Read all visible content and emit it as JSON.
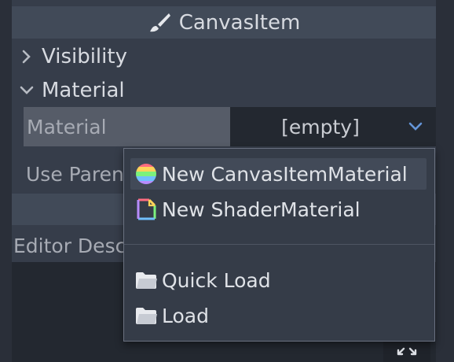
{
  "inspector": {
    "header_title": "CanvasItem",
    "sections": [
      {
        "label": "Visibility",
        "expanded": false
      },
      {
        "label": "Material",
        "expanded": true
      }
    ],
    "material_label": "Material",
    "material_value": "[empty]",
    "use_parent_label": "Use Parent Material",
    "editor_description_label": "Editor Description",
    "editor_description_value": ""
  },
  "dropdown_menu": {
    "items": [
      {
        "label": "New CanvasItemMaterial",
        "icon": "canvasitemmaterial-icon",
        "hovered": true
      },
      {
        "label": "New ShaderMaterial",
        "icon": "shadermaterial-icon",
        "hovered": false
      },
      {
        "label": "Quick Load",
        "icon": "folder-icon",
        "hovered": false
      },
      {
        "label": "Load",
        "icon": "folder-icon",
        "hovered": false
      }
    ]
  },
  "colors": {
    "background": "#363d4a",
    "header": "#414a58",
    "field_bg": "#232830",
    "label_highlight": "#565c68",
    "accent": "#6495d8"
  }
}
